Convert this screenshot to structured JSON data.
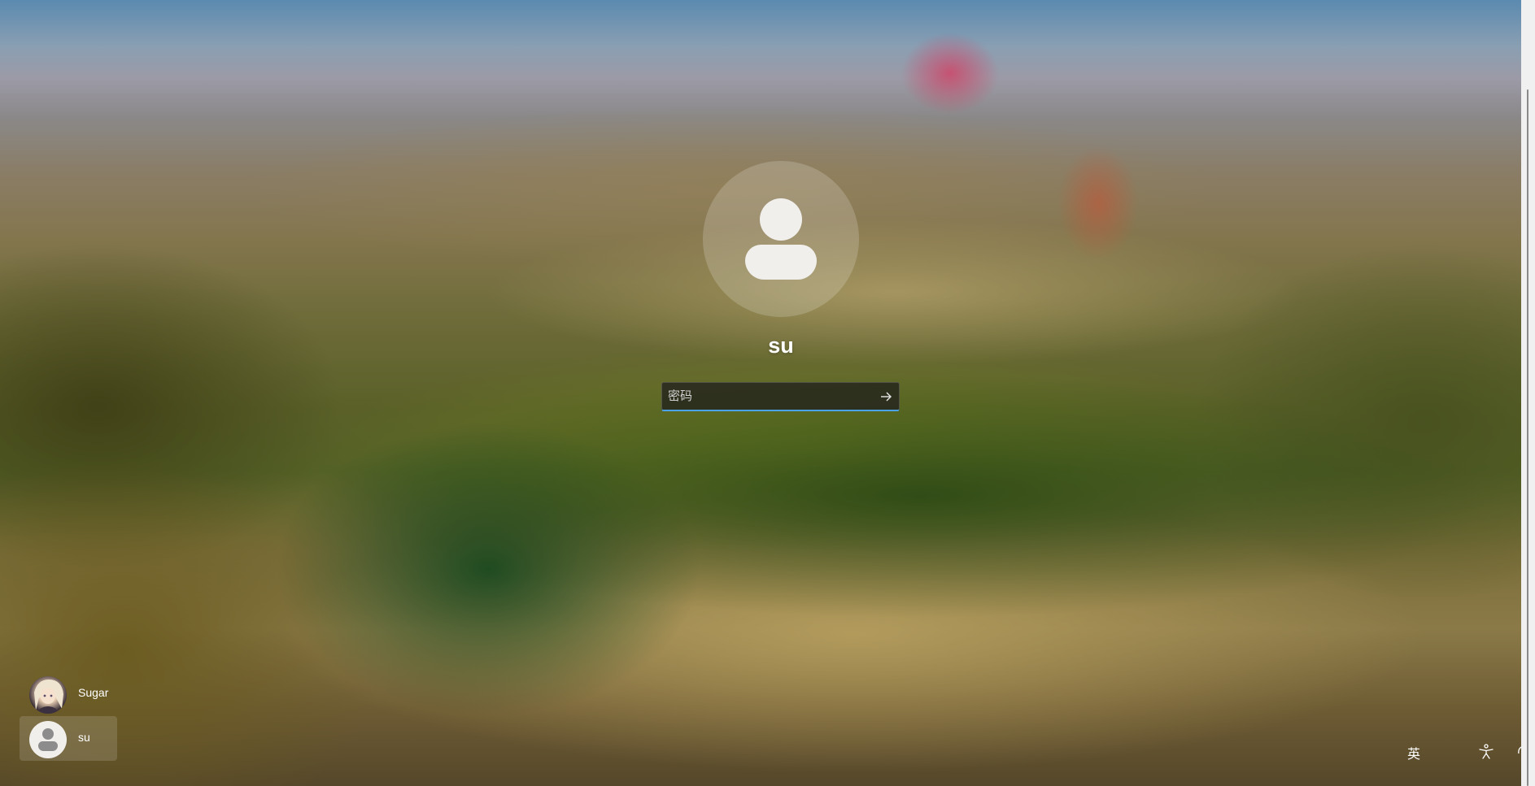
{
  "login": {
    "username": "su",
    "password_placeholder": "密码",
    "password_value": "",
    "submit_icon": "arrow-right-icon",
    "accent_color": "#4aa3e8"
  },
  "users": [
    {
      "name": "Sugar",
      "avatar": "anime-portrait",
      "selected": false
    },
    {
      "name": "su",
      "avatar": "generic-person-icon",
      "selected": true
    }
  ],
  "tray": {
    "ime_label": "英",
    "accessibility_icon": "accessibility-icon"
  }
}
